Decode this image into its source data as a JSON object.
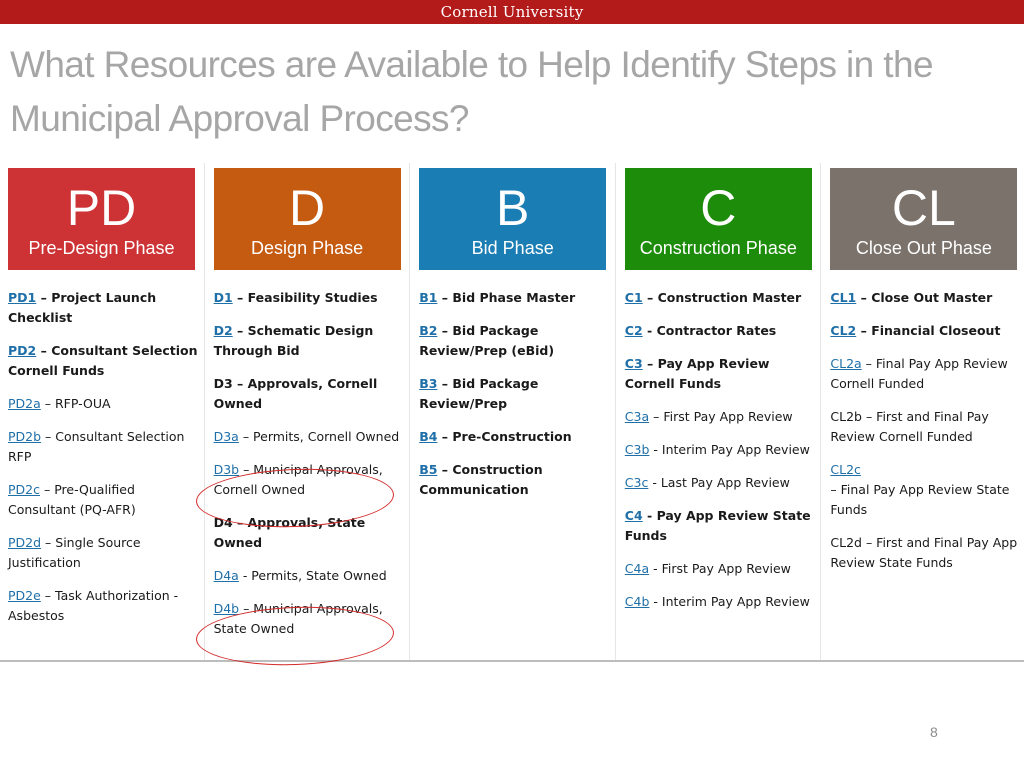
{
  "header": {
    "institution": "Cornell University",
    "brand_color": "#b31b1b"
  },
  "slide": {
    "title": "What Resources are Available to Help Identify Steps in the Municipal Approval Process?",
    "page_number": "8"
  },
  "phases": [
    {
      "code": "PD",
      "name": "Pre-Design Phase",
      "color": "#cd3235",
      "items": [
        {
          "link": "PD1",
          "text": " – Project Launch Checklist",
          "bold": true
        },
        {
          "link": "PD2",
          "text": " – Consultant Selection Cornell Funds",
          "bold": true
        },
        {
          "link": "PD2a",
          "text": " – RFP-OUA",
          "bold": false
        },
        {
          "link": "PD2b",
          "text": " – Consultant Selection RFP",
          "bold": false
        },
        {
          "link": "PD2c",
          "text": " – Pre-Qualified Consultant (PQ-AFR)",
          "bold": false
        },
        {
          "link": "PD2d",
          "text": " – Single Source Justification",
          "bold": false
        },
        {
          "link": "PD2e",
          "text": " – Task Authorization - Asbestos",
          "bold": false
        }
      ]
    },
    {
      "code": "D",
      "name": "Design Phase",
      "color": "#c55a11",
      "items": [
        {
          "link": "D1",
          "text": " – Feasibility Studies",
          "bold": true
        },
        {
          "link": "D2",
          "text": " – Schematic Design Through Bid",
          "bold": true
        },
        {
          "link": "",
          "text": "D3 – Approvals, Cornell Owned",
          "bold": true
        },
        {
          "link": "D3a",
          "text": " – Permits, Cornell Owned",
          "bold": false
        },
        {
          "link": "D3b",
          "text": " – Municipal Approvals, Cornell Owned",
          "bold": false,
          "highlighted": true
        },
        {
          "link": "",
          "text": "D4 – Approvals, State Owned",
          "bold": true
        },
        {
          "link": "D4a",
          "text": " - Permits, State Owned",
          "bold": false
        },
        {
          "link": "D4b",
          "text": " – Municipal Approvals, State Owned",
          "bold": false,
          "highlighted": true
        }
      ]
    },
    {
      "code": "B",
      "name": "Bid Phase",
      "color": "#1a7db3",
      "items": [
        {
          "link": "B1",
          "text": " – Bid Phase Master",
          "bold": true
        },
        {
          "link": "B2",
          "text": " – Bid Package Review/Prep (eBid)",
          "bold": true
        },
        {
          "link": "B3",
          "text": " – Bid Package Review/Prep",
          "bold": true
        },
        {
          "link": "B4",
          "text": " – Pre-Construction",
          "bold": true
        },
        {
          "link": "B5",
          "text": " – Construction Communication",
          "bold": true
        }
      ]
    },
    {
      "code": "C",
      "name": "Construction Phase",
      "color": "#1e8c0b",
      "items": [
        {
          "link": "C1",
          "text": " – Construction Master",
          "bold": true
        },
        {
          "link": "C2",
          "text": " - Contractor Rates",
          "bold": true
        },
        {
          "link": "C3",
          "text": " – Pay App Review Cornell Funds",
          "bold": true
        },
        {
          "link": "C3a",
          "text": " – First Pay App Review",
          "bold": false
        },
        {
          "link": "C3b",
          "text": " - Interim Pay App Review",
          "bold": false
        },
        {
          "link": "C3c",
          "text": " - Last Pay App Review",
          "bold": false
        },
        {
          "link": "C4",
          "text": " - Pay App Review State Funds",
          "bold": true
        },
        {
          "link": "C4a",
          "text": " - First Pay App Review",
          "bold": false
        },
        {
          "link": "C4b",
          "text": " - Interim Pay App Review",
          "bold": false
        }
      ]
    },
    {
      "code": "CL",
      "name": "Close Out Phase",
      "color": "#7a726b",
      "items": [
        {
          "link": "CL1",
          "text": " – Close Out Master",
          "bold": true
        },
        {
          "link": "CL2",
          "text": " – Financial Closeout",
          "bold": true
        },
        {
          "link": "CL2a",
          "text": " – Final Pay App Review Cornell Funded",
          "bold": false
        },
        {
          "link": "",
          "text": "CL2b – First and Final Pay Review Cornell Funded",
          "bold": false
        },
        {
          "link": "CL2c",
          "text": " – Final Pay App Review State Funds",
          "bold": false,
          "break_after_link": true
        },
        {
          "link": "",
          "text": "CL2d – First and Final Pay App Review State Funds",
          "bold": false
        }
      ]
    }
  ]
}
